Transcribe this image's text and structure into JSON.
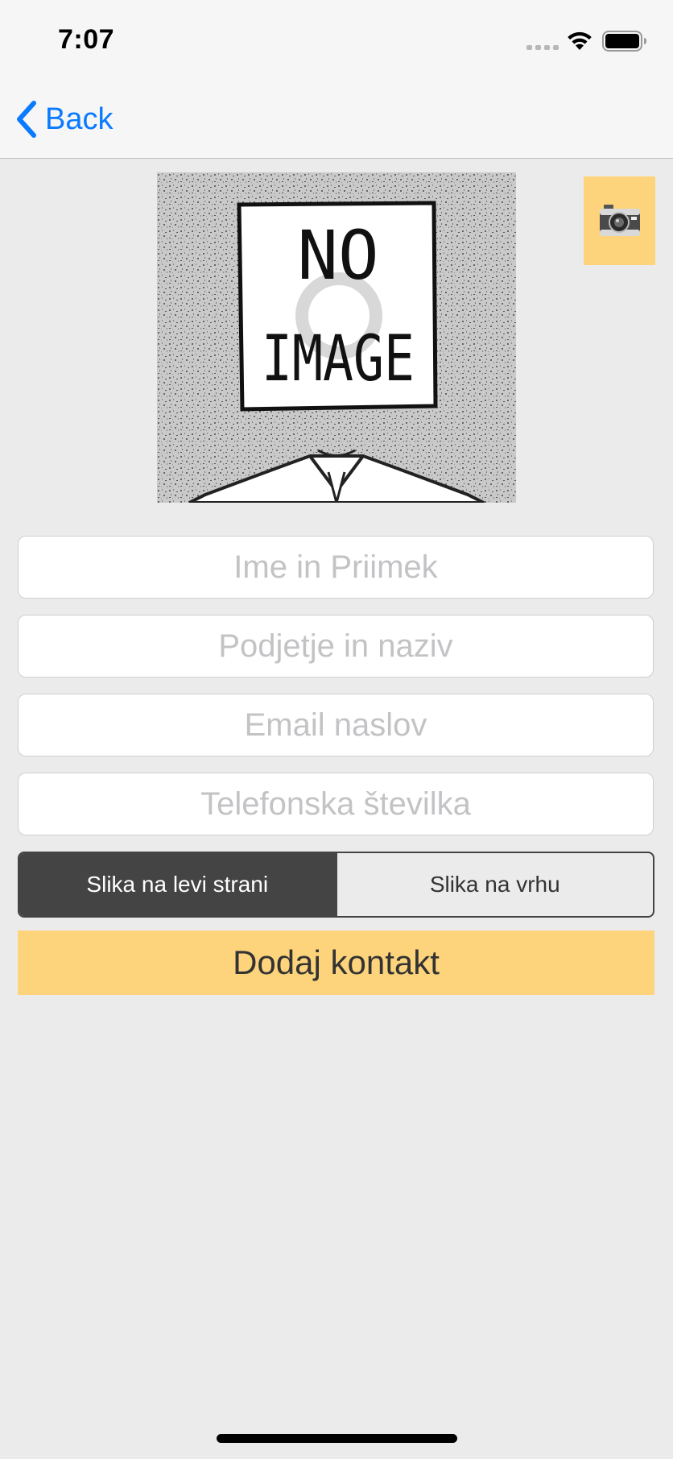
{
  "status_bar": {
    "time": "7:07"
  },
  "nav": {
    "back_label": "Back"
  },
  "image": {
    "line1": "NO",
    "line2": "IMAGE"
  },
  "form": {
    "name_placeholder": "Ime in Priimek",
    "company_placeholder": "Podjetje in naziv",
    "email_placeholder": "Email naslov",
    "phone_placeholder": "Telefonska številka",
    "name_value": "",
    "company_value": "",
    "email_value": "",
    "phone_value": ""
  },
  "layout_toggle": {
    "options": [
      "Slika na levi strani",
      "Slika na vrhu"
    ],
    "selected": "Slika na levi strani"
  },
  "add_button_label": "Dodaj kontakt",
  "icons": {
    "back": "chevron-left-icon",
    "camera": "camera-icon",
    "signal": "cellular-signal-icon",
    "wifi": "wifi-icon",
    "battery": "battery-icon"
  },
  "colors": {
    "accent_yellow": "#fdd47b",
    "ios_blue": "#0a7aff",
    "segment_dark": "#444444",
    "background": "#ebebeb"
  }
}
